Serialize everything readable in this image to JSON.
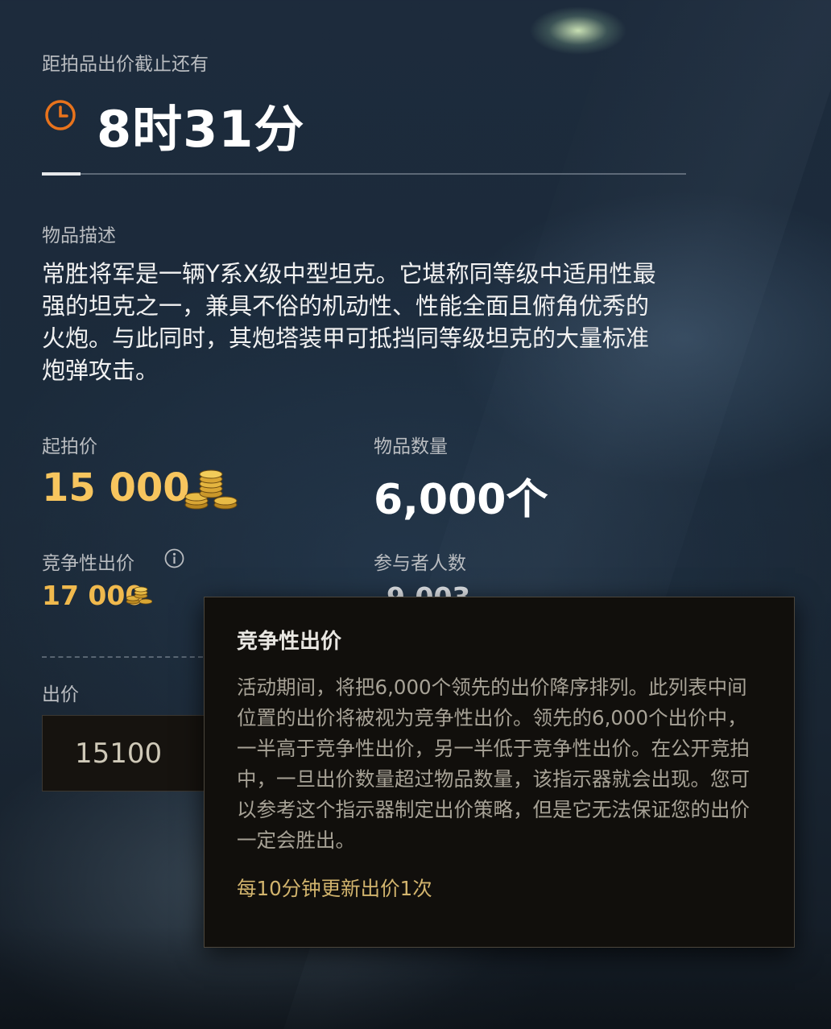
{
  "countdown": {
    "label": "距拍品出价截止还有",
    "value": "8时31分"
  },
  "description": {
    "label": "物品描述",
    "text": "常胜将军是一辆Y系X级中型坦克。它堪称同等级中适用性最强的坦克之一，兼具不俗的机动性、性能全面且俯角优秀的火炮。与此同时，其炮塔装甲可抵挡同等级坦克的大量标准炮弹攻击。"
  },
  "start_price": {
    "label": "起拍价",
    "value": "15 000",
    "icon": "gold-coins-icon"
  },
  "quantity": {
    "label": "物品数量",
    "value": "6,000个"
  },
  "competitive_bid": {
    "label": "竞争性出价",
    "value": "17 000",
    "icon": "gold-coins-icon"
  },
  "participants": {
    "label": "参与者人数",
    "value_partial": "9,003"
  },
  "bid": {
    "label": "出价",
    "input_value": "15100"
  },
  "tooltip": {
    "title": "竞争性出价",
    "body": "活动期间，将把6,000个领先的出价降序排列。此列表中间位置的出价将被视为竞争性出价。领先的6,000个出价中，一半高于竞争性出价，另一半低于竞争性出价。在公开竞拍中，一旦出价数量超过物品数量，该指示器就会出现。您可以参考这个指示器制定出价策略，但是它无法保证您的出价一定会胜出。",
    "note": "每10分钟更新出价1次"
  },
  "colors": {
    "accent_gold": "#f7c55e",
    "clock_orange": "#e8731c",
    "tooltip_note": "#d2b46d"
  }
}
